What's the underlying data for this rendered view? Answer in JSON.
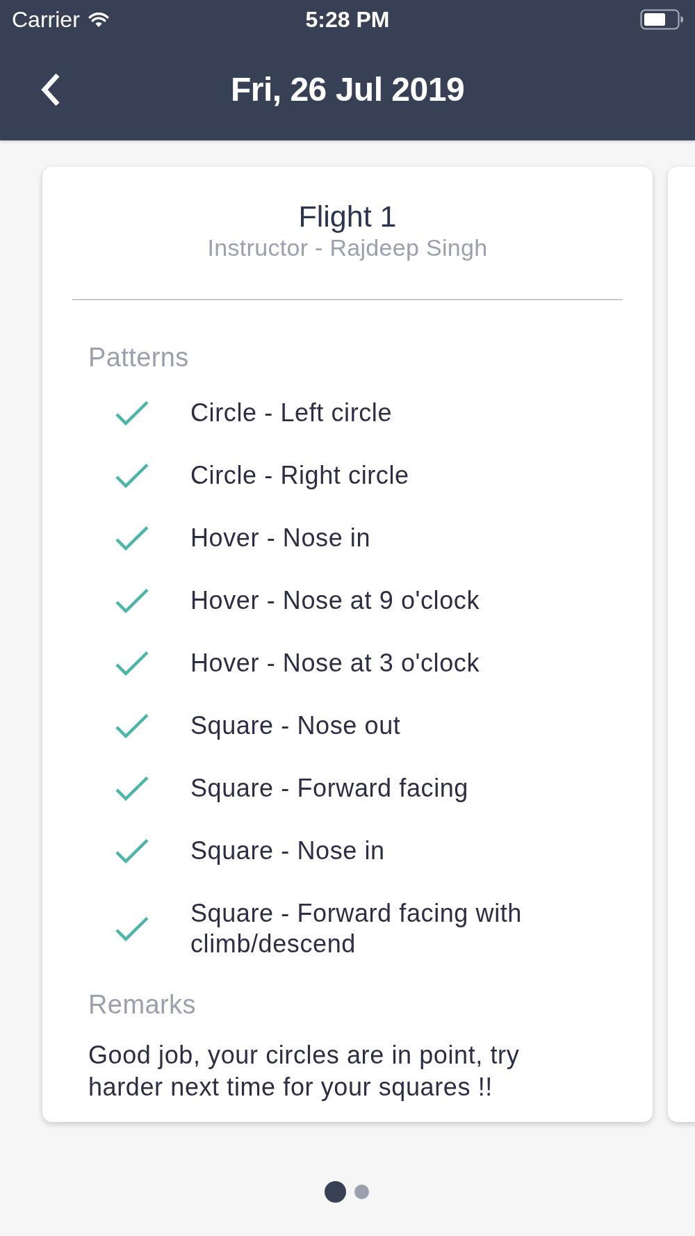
{
  "status_bar": {
    "carrier": "Carrier",
    "time": "5:28 PM"
  },
  "header": {
    "title": "Fri, 26 Jul 2019"
  },
  "cards": [
    {
      "title": "Flight 1",
      "subtitle": "Instructor - Rajdeep Singh",
      "sections": [
        {
          "kind": "checklist",
          "heading": "Patterns",
          "items": [
            {
              "label": "Circle - Left circle",
              "checked": true
            },
            {
              "label": "Circle - Right circle",
              "checked": true
            },
            {
              "label": "Hover - Nose in",
              "checked": true
            },
            {
              "label": "Hover - Nose at 9 o'clock",
              "checked": true
            },
            {
              "label": "Hover - Nose at 3 o'clock",
              "checked": true
            },
            {
              "label": "Square - Nose out",
              "checked": true
            },
            {
              "label": "Square - Forward facing",
              "checked": true
            },
            {
              "label": "Square - Nose in",
              "checked": true
            },
            {
              "label": "Square - Forward facing with climb/descend",
              "checked": true
            }
          ]
        },
        {
          "kind": "text",
          "heading": "Remarks",
          "body": "Good job, your circles are in point, try harder next time for your squares !!"
        }
      ]
    }
  ],
  "pager": [
    {
      "selected": true
    },
    {
      "selected": false
    }
  ]
}
